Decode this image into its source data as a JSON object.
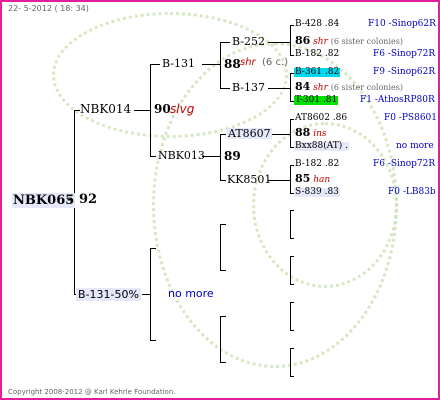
{
  "header": {
    "date": "22- 5-2012 ( 18: 34)"
  },
  "footer": {
    "copyright": "Copyright 2008-2012 @ Karl Kehrle Foundation."
  },
  "root": {
    "id": "NBK065",
    "value": "92"
  },
  "gen1": [
    {
      "id": "NBK014",
      "value": "90",
      "tag": "slvg"
    },
    {
      "id": "B-131-50%",
      "note": "no more"
    }
  ],
  "gen2": [
    {
      "id": "B-131",
      "value": "88",
      "tag": "shr",
      "colonies": "(6 c.)"
    },
    {
      "id": "NBK013",
      "value": "89"
    }
  ],
  "gen3": [
    {
      "id": "B-252",
      "value": "86",
      "tag": "shr",
      "colonies": "(6 sister colonies)"
    },
    {
      "id": "B-137",
      "value": "84",
      "tag": "shr",
      "colonies": "(6 sister colonies)"
    },
    {
      "id": "AT8607",
      "value": "88",
      "tag": "ins"
    },
    {
      "id": "KK8501",
      "value": "85",
      "tag": "han"
    }
  ],
  "gen4": [
    {
      "id": "B-428",
      "score": ".84",
      "ref": "F10 -Sinop62R"
    },
    {
      "id": "B-182",
      "score": ".82",
      "ref": "F6 -Sinop72R"
    },
    {
      "id": "B-361",
      "score": ".82",
      "ref": "F9 -Sinop62R"
    },
    {
      "id": "T-301",
      "score": ".81",
      "ref": "F1 -AthosRP80R"
    },
    {
      "id": "AT8602",
      "score": ".86",
      "ref": "F0 -PS8601"
    },
    {
      "id": "Bxx88(AT)",
      "score": ".",
      "ref": "no more"
    },
    {
      "id": "B-182",
      "score": ".82",
      "ref": "F6 -Sinop72R"
    },
    {
      "id": "S-839",
      "score": ".83",
      "ref": "F0 -LB83b"
    }
  ],
  "colors": {
    "border": "#e0209a",
    "highlight_cyan": "#00d8f0",
    "highlight_green": "#00e000",
    "pale_blue": "#e4e8f8",
    "link_blue": "#0000c8",
    "tag_red": "#c80000"
  }
}
